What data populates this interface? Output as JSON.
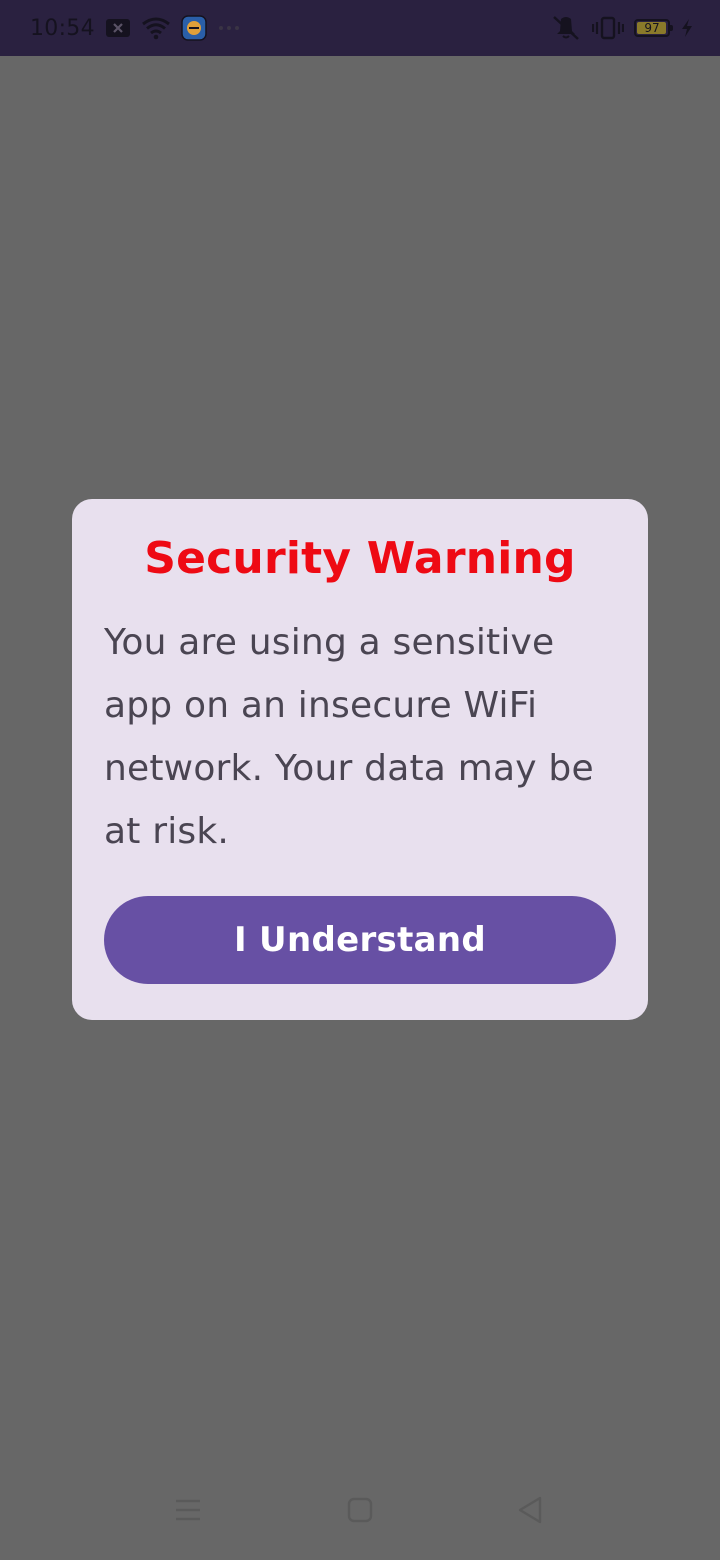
{
  "status_bar": {
    "time": "10:54",
    "battery_level": "97",
    "icons": [
      "notification-icon",
      "wifi-icon",
      "app-icon",
      "more-dots-icon",
      "vibrate-off-icon",
      "vibrate-icon",
      "battery-icon",
      "charging-icon"
    ]
  },
  "dialog": {
    "title": "Security Warning",
    "message": "You are using a sensitive app on an insecure WiFi network. Your data may be at risk.",
    "button_label": "I Understand"
  },
  "colors": {
    "scrim": "#676767",
    "status_bar": "#2a2140",
    "dialog_bg": "#e8e0ee",
    "title": "#ee0a14",
    "message": "#4a4552",
    "button": "#6750a4",
    "button_text": "#ffffff"
  },
  "nav_bar": {
    "buttons": [
      "menu-icon",
      "home-icon",
      "back-icon"
    ]
  }
}
